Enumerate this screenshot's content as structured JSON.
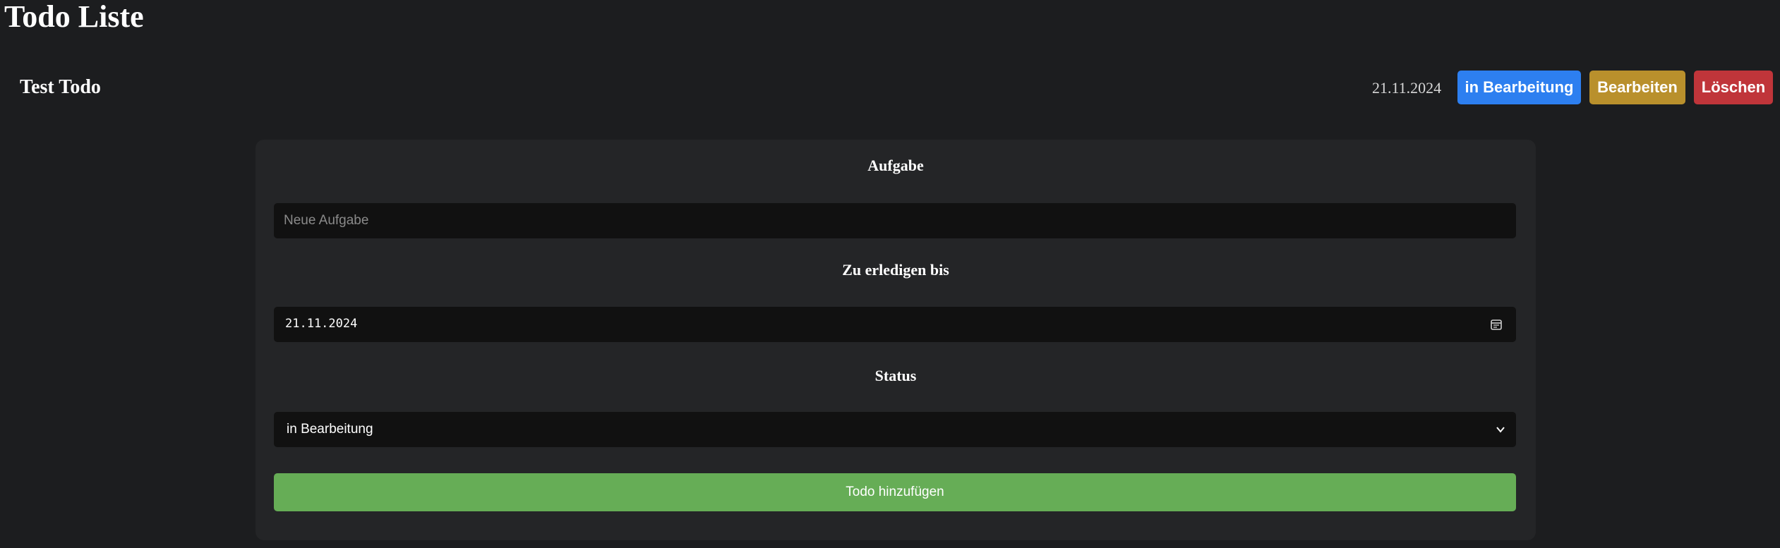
{
  "page": {
    "title": "Todo Liste"
  },
  "todo": {
    "title": "Test Todo",
    "date": "21.11.2024",
    "status_label": "in Bearbeitung",
    "edit_label": "Bearbeiten",
    "delete_label": "Löschen"
  },
  "form": {
    "task_label": "Aufgabe",
    "task_placeholder": "Neue Aufgabe",
    "task_value": "",
    "due_label": "Zu erledigen bis",
    "due_value": "21.11.2024",
    "status_label": "Status",
    "status_selected": "in Bearbeitung",
    "submit_label": "Todo hinzufügen"
  },
  "icons": {
    "calendar": "calendar-icon",
    "dropdown": "chevron-down-icon"
  },
  "colors": {
    "background": "#1c1d1f",
    "card": "#242527",
    "input": "#111111",
    "status_button": "#2d7ff0",
    "edit_button": "#b9902c",
    "delete_button": "#c0353a",
    "submit_button": "#66ad56"
  }
}
